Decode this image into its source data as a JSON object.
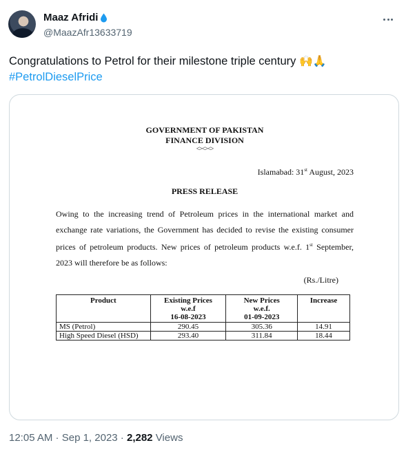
{
  "author": {
    "display_name": "Maaz Afridi",
    "handle": "@MaazAfr13633719",
    "badge_icon": "water-drop-icon",
    "badge_color": "#1d9bf0"
  },
  "tweet": {
    "text": "Congratulations to Petrol for their milestone triple century",
    "emojis": "🙌🙏",
    "hashtag": "#PetrolDieselPrice"
  },
  "document": {
    "gov": "GOVERNMENT OF PAKISTAN",
    "division": "FINANCE DIVISION",
    "ornament": "<><><>",
    "date_prefix": "Islamabad: 31",
    "date_sup": "st",
    "date_suffix": " August, 2023",
    "title": "PRESS RELEASE",
    "para_main": "Owing to the increasing trend of Petroleum prices in the international market and exchange rate variations, the Government has decided to revise the existing consumer prices of petroleum products. New prices of petroleum products w.e.f. 1",
    "para_sup": "st",
    "para_end": " September, 2023 will therefore be as follows:",
    "unit": "(Rs./Litre)",
    "table": {
      "headers": [
        [
          "Product"
        ],
        [
          "Existing Prices",
          "w.e.f",
          "16-08-2023"
        ],
        [
          "New Prices",
          "w.e.f.",
          "01-09-2023"
        ],
        [
          "Increase"
        ]
      ],
      "rows": [
        [
          "MS (Petrol)",
          "290.45",
          "305.36",
          "14.91"
        ],
        [
          "High Speed Diesel (HSD)",
          "293.40",
          "311.84",
          "18.44"
        ]
      ]
    }
  },
  "meta": {
    "time": "12:05 AM",
    "sep1": " · ",
    "date": "Sep 1, 2023",
    "sep2": " · ",
    "views_count": "2,282",
    "views_label": " Views"
  }
}
